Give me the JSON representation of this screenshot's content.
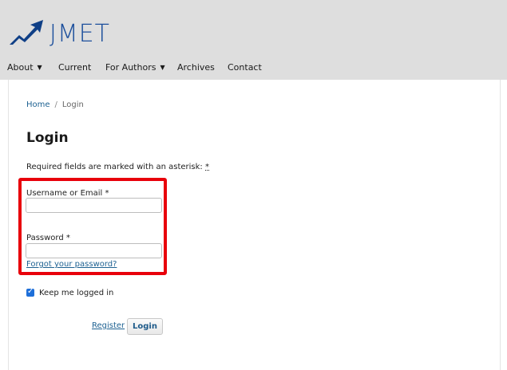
{
  "site": {
    "logo_text": "JMET"
  },
  "nav": {
    "items": [
      {
        "label": "About",
        "has_dropdown": true
      },
      {
        "label": "Current",
        "has_dropdown": false
      },
      {
        "label": "For Authors",
        "has_dropdown": true
      },
      {
        "label": "Archives",
        "has_dropdown": false
      },
      {
        "label": "Contact",
        "has_dropdown": false
      }
    ]
  },
  "breadcrumb": {
    "home": "Home",
    "separator": "/",
    "current": "Login"
  },
  "page": {
    "title": "Login",
    "required_note": "Required fields are marked with an asterisk:",
    "required_marker": "*"
  },
  "form": {
    "username_label": "Username or Email *",
    "username_value": "",
    "password_label": "Password *",
    "password_value": "",
    "forgot_link": "Forgot your password?",
    "keep_logged_in_label": "Keep me logged in",
    "keep_logged_in_checked": true,
    "register_link": "Register",
    "login_button": "Login"
  },
  "colors": {
    "header_bg": "#dedede",
    "brand": "#1c4f9c",
    "link": "#1e6292",
    "highlight": "#e8000b",
    "checkbox": "#1e6fd9"
  }
}
